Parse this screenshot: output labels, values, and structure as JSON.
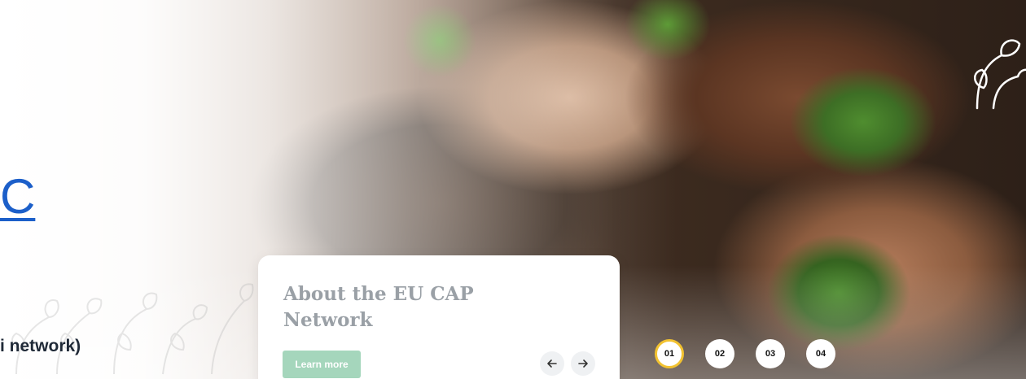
{
  "hero": {
    "heading_fragment": "C",
    "subtitle_fragment": "i network)"
  },
  "card": {
    "title": "About the EU CAP Network",
    "learn_more_label": "Learn more",
    "prev_icon": "arrow-left-icon",
    "next_icon": "arrow-right-icon"
  },
  "pagination": {
    "pages": [
      "01",
      "02",
      "03",
      "04"
    ],
    "active": "01"
  },
  "colors": {
    "heading_blue": "#1c5fc9",
    "active_ring": "#f2c230",
    "learn_more_bg": "#a5d6bc"
  }
}
